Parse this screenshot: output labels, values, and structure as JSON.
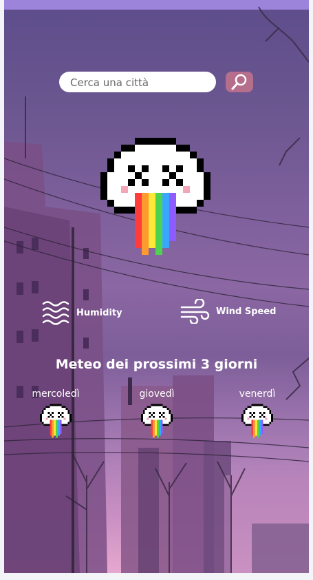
{
  "search": {
    "placeholder": "Cerca una città"
  },
  "current": {
    "weather_icon": "rainbow-mushroom-icon"
  },
  "stats": [
    {
      "label": "Humidity",
      "icon": "waves-icon"
    },
    {
      "label": "Wind Speed",
      "icon": "wind-icon"
    }
  ],
  "forecast": {
    "title": "Meteo dei prossimi 3 giorni",
    "days": [
      {
        "name": "mercoledì",
        "icon": "rainbow-mushroom-icon"
      },
      {
        "name": "giovedì",
        "icon": "rainbow-mushroom-icon"
      },
      {
        "name": "venerdì",
        "icon": "rainbow-mushroom-icon"
      }
    ]
  },
  "colors": {
    "topbar": "#9b84d9",
    "search_button": "#b56e8c",
    "text": "#ffffff"
  }
}
